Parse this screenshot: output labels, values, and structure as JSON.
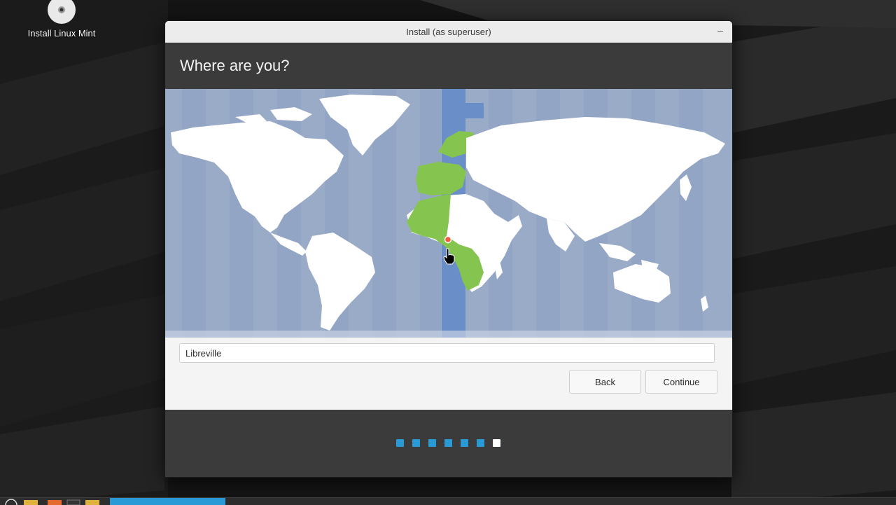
{
  "desktop": {
    "icon_label": "Install Linux Mint"
  },
  "window": {
    "title": "Install (as superuser)",
    "minimize_glyph": "–"
  },
  "page": {
    "heading": "Where are you?"
  },
  "location": {
    "value": "Libreville"
  },
  "buttons": {
    "back": "Back",
    "continue": "Continue"
  },
  "progress": {
    "total_steps": 7,
    "current_step": 7
  },
  "colors": {
    "map_ocean": "#9aabc8",
    "map_land": "#ffffff",
    "timezone_highlight": "#6a8ec8",
    "selected_region": "#86c450",
    "step_dot": "#2a9ad6",
    "step_dot_active": "#ffffff",
    "header_bg": "#3b3b3b"
  },
  "icons": {
    "desktop_icon": "disc-icon",
    "map_pin": "location-pin-icon",
    "cursor": "hand-pointer-icon"
  }
}
